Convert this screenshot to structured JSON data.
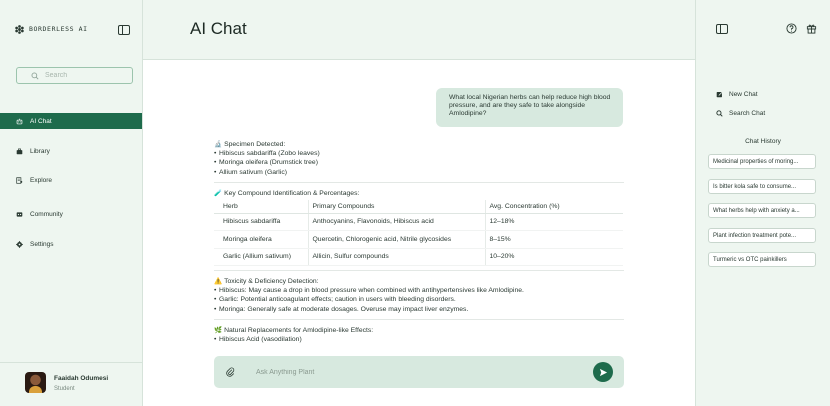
{
  "brand": {
    "name": "BORDERLESS AI"
  },
  "search": {
    "placeholder": "Search"
  },
  "nav": [
    {
      "label": "AI Chat",
      "icon": "robot-icon",
      "active": true
    },
    {
      "label": "Library",
      "icon": "briefcase-icon",
      "active": false
    },
    {
      "label": "Explore",
      "icon": "document-search-icon",
      "active": false
    },
    {
      "label": "Community",
      "icon": "community-icon",
      "active": false
    },
    {
      "label": "Settings",
      "icon": "gear-icon",
      "active": false
    }
  ],
  "user": {
    "name": "Faaidah Odumesi",
    "role": "Student"
  },
  "header": {
    "title": "AI Chat"
  },
  "chat": {
    "user_message": "What local Nigerian herbs can help reduce high blood pressure, and are they safe to take alongside Amlodipine?",
    "specimen": {
      "emoji": "🔬",
      "title": "Specimen Detected:",
      "items": [
        "Hibiscus sabdariffa (Zobo leaves)",
        "Moringa oleifera (Drumstick tree)",
        "Allium sativum (Garlic)"
      ]
    },
    "compounds": {
      "emoji": "🧪",
      "title": "Key Compound Identification & Percentages:",
      "headers": [
        "Herb",
        "Primary Compounds",
        "Avg. Concentration (%)"
      ],
      "rows": [
        [
          "Hibiscus sabdariffa",
          "Anthocyanins, Flavonoids, Hibiscus acid",
          "12–18%"
        ],
        [
          "Moringa oleifera",
          "Quercetin, Chlorogenic acid, Nitrile glycosides",
          "8–15%"
        ],
        [
          "Garlic (Allium sativum)",
          "Allicin, Sulfur compounds",
          "10–20%"
        ]
      ]
    },
    "toxicity": {
      "emoji": "⚠️",
      "title": "Toxicity & Deficiency Detection:",
      "items": [
        "Hibiscus: May cause a drop in blood pressure when combined with antihypertensives like Amlodipine.",
        "Garlic: Potential anticoagulant effects; caution in users with bleeding disorders.",
        "Moringa: Generally safe at moderate dosages. Overuse may impact liver enzymes."
      ]
    },
    "replacements": {
      "emoji": "🌿",
      "title": "Natural Replacements for Amlodipine-like Effects:",
      "items": [
        "Hibiscus Acid (vasodilation)"
      ]
    }
  },
  "composer": {
    "placeholder": "Ask Anything Plant"
  },
  "right_panel": {
    "actions": [
      {
        "label": "New Chat",
        "icon": "new-chat-icon"
      },
      {
        "label": "Search Chat",
        "icon": "search-icon"
      }
    ],
    "history_title": "Chat History",
    "history": [
      "Medicinal properties of moring...",
      "Is bitter kola safe to consume...",
      "What herbs help with anxiety a...",
      "Plant infection treatment pote...",
      "Turmeric vs OTC painkillers"
    ]
  },
  "colors": {
    "accent": "#1e6b4c",
    "panel_bg": "#eef6f0",
    "bubble_bg": "#d7e9df"
  }
}
